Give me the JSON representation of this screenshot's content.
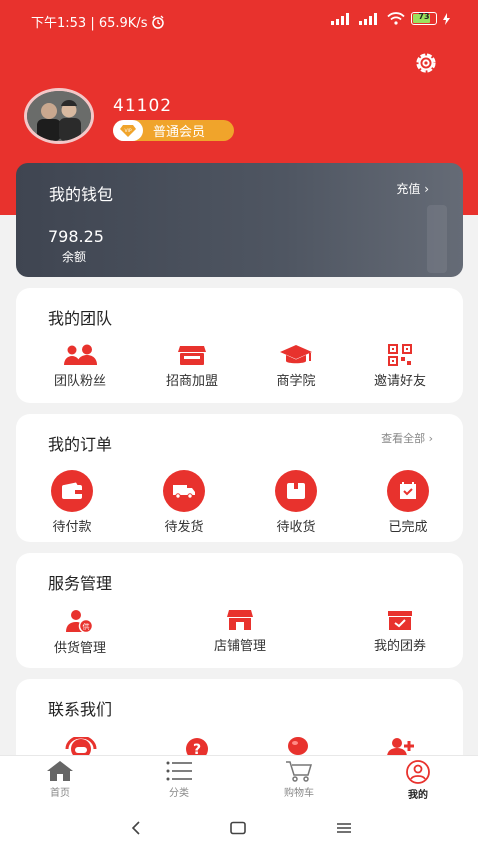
{
  "status": {
    "time_speed": "下午1:53 | 65.9K/s",
    "network1": "HD",
    "network2": "HD",
    "battery": "73"
  },
  "profile": {
    "username": "41102",
    "vip_tag": "VIP",
    "member_level": "普通会员"
  },
  "wallet": {
    "title": "我的钱包",
    "recharge": "充值 ›",
    "amount": "798.25",
    "amount_label": "余额"
  },
  "team": {
    "title": "我的团队",
    "items": [
      {
        "label": "团队粉丝",
        "icon": "fans-icon"
      },
      {
        "label": "招商加盟",
        "icon": "franchise-icon"
      },
      {
        "label": "商学院",
        "icon": "academy-icon"
      },
      {
        "label": "邀请好友",
        "icon": "qrcode-icon"
      }
    ]
  },
  "orders": {
    "title": "我的订单",
    "view_all": "查看全部   ›",
    "items": [
      {
        "label": "待付款",
        "icon": "wallet-icon"
      },
      {
        "label": "待发货",
        "icon": "truck-icon"
      },
      {
        "label": "待收货",
        "icon": "package-icon"
      },
      {
        "label": "已完成",
        "icon": "completed-icon"
      }
    ]
  },
  "service": {
    "title": "服务管理",
    "items": [
      {
        "label": "供货管理",
        "icon": "supply-icon",
        "badge": "供"
      },
      {
        "label": "店铺管理",
        "icon": "shop-icon"
      },
      {
        "label": "我的团券",
        "icon": "coupon-icon"
      }
    ]
  },
  "contact": {
    "title": "联系我们",
    "items": [
      {
        "icon": "customer-service-icon"
      },
      {
        "icon": "help-icon"
      },
      {
        "icon": "balloon-icon"
      },
      {
        "icon": "add-user-icon"
      }
    ]
  },
  "tabs": [
    {
      "label": "首页",
      "icon": "home-icon"
    },
    {
      "label": "分类",
      "icon": "category-icon"
    },
    {
      "label": "购物车",
      "icon": "cart-icon"
    },
    {
      "label": "我的",
      "icon": "profile-icon"
    }
  ],
  "colors": {
    "brand_red": "#e8322d",
    "wallet_bg": "#4a505b",
    "badge_gold": "#f0a42b"
  }
}
